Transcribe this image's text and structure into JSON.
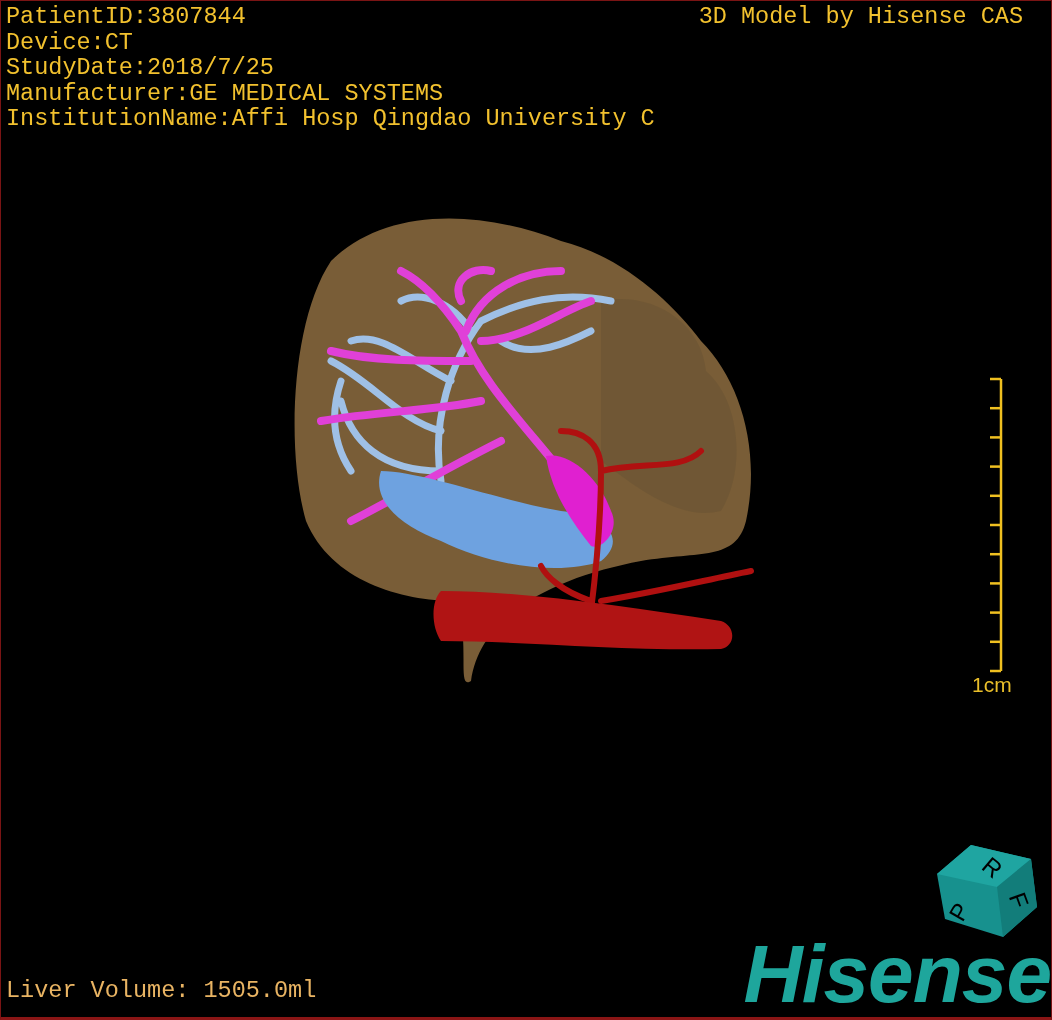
{
  "info_lines": [
    "PatientID:3807844",
    "Device:CT",
    "StudyDate:2018/7/25",
    "Manufacturer:GE MEDICAL SYSTEMS",
    "InstitutionName:Affi Hosp Qingdao University C"
  ],
  "model_caption": "3D Model by Hisense CAS",
  "scale": {
    "label": "1cm"
  },
  "orientation_cube": {
    "faces": [
      "P",
      "R",
      "F"
    ]
  },
  "liver_volume": "Liver Volume: 1505.0ml",
  "logo": "Hisense"
}
